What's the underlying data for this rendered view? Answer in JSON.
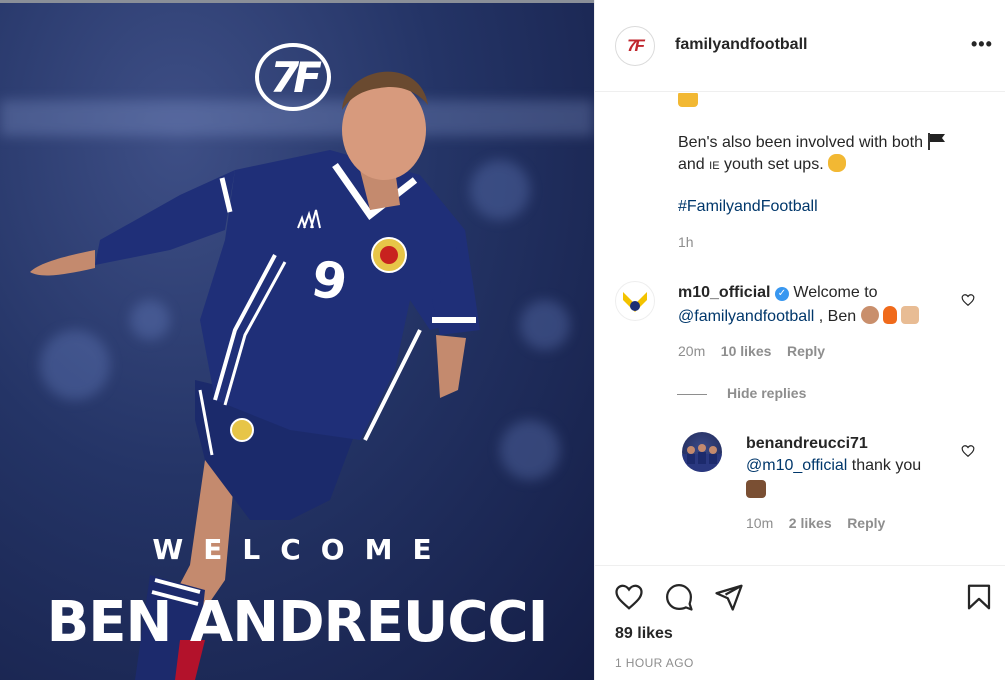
{
  "post": {
    "username": "familyandfootball",
    "avatar_text": "7F",
    "more_icon": "•••",
    "image": {
      "logo_text": "7F",
      "welcome": "WELCOME",
      "player_name": "BEN ANDREUCCI",
      "shirt_number": "9"
    }
  },
  "caption": {
    "line1_prefix": "Ben's also been involved with both",
    "line2_prefix": "and",
    "flag_text": "IE",
    "line2_suffix": "youth set ups.",
    "hashtag": "#FamilyandFootball",
    "timestamp": "1h"
  },
  "comments": [
    {
      "username": "m10_official",
      "verified": true,
      "text_prefix": "Welcome to",
      "mention": "@familyandfootball",
      "text_suffix": ", Ben",
      "time": "20m",
      "likes": "10 likes",
      "reply": "Reply",
      "hide_replies": "Hide replies"
    },
    {
      "username": "benandreucci71",
      "mention": "@m10_official",
      "text": "thank you",
      "time": "10m",
      "likes": "2 likes",
      "reply": "Reply"
    }
  ],
  "actions": {
    "likes": "89 likes",
    "time": "1 HOUR AGO",
    "icons": [
      "heart-icon",
      "comment-icon",
      "share-icon",
      "bookmark-icon"
    ]
  },
  "colors": {
    "link": "#00376b",
    "muted": "#8e8e8e",
    "verified": "#3897f0",
    "shirt": "#1f2f78"
  }
}
